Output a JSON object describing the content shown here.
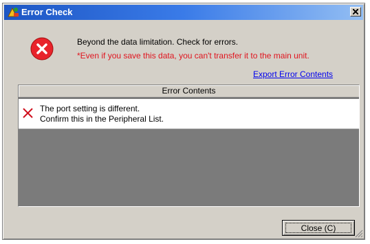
{
  "window": {
    "title": "Error Check",
    "close_glyph": "×"
  },
  "message": {
    "line1": "Beyond the data limitation. Check for errors.",
    "line2": "*Even if you save this data, you can't transfer it to the main unit.",
    "error_icon": "error-circle-x-icon",
    "warning_color": "#e0141e"
  },
  "export_link": "Export Error Contents",
  "panel": {
    "header": "Error Contents",
    "rows": [
      {
        "icon": "red-x-icon",
        "line1": "The port setting is different.",
        "line2": "Confirm this in the Peripheral List."
      }
    ]
  },
  "close_button": "Close (C)",
  "colors": {
    "title_start": "#1d56c4",
    "title_end": "#93bef3",
    "link": "#0000ee",
    "error": "#e0141e"
  }
}
